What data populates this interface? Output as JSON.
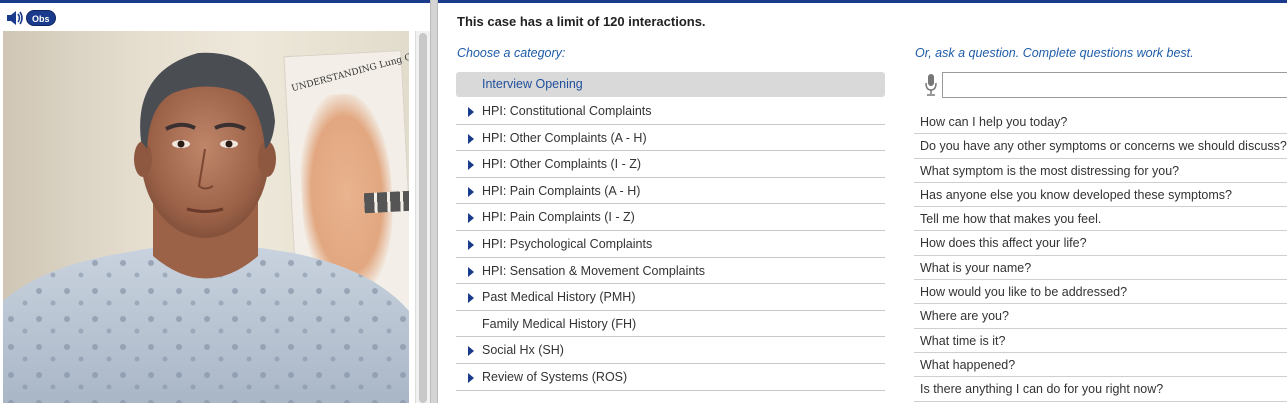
{
  "media": {
    "obs_label": "Obs"
  },
  "poster": {
    "title": "UNDERSTANDING Lung Cancer"
  },
  "header": {
    "limit_text": "This case has a limit of 120 interactions."
  },
  "categories": {
    "prompt": "Choose a category:",
    "items": [
      {
        "label": "Interview Opening",
        "expandable": false,
        "selected": true
      },
      {
        "label": "HPI: Constitutional Complaints",
        "expandable": true
      },
      {
        "label": "HPI: Other Complaints (A - H)",
        "expandable": true
      },
      {
        "label": "HPI: Other Complaints (I - Z)",
        "expandable": true
      },
      {
        "label": "HPI: Pain Complaints (A - H)",
        "expandable": true
      },
      {
        "label": "HPI: Pain Complaints (I - Z)",
        "expandable": true
      },
      {
        "label": "HPI: Psychological Complaints",
        "expandable": true
      },
      {
        "label": "HPI: Sensation & Movement Complaints",
        "expandable": true
      },
      {
        "label": "Past Medical History (PMH)",
        "expandable": true
      },
      {
        "label": "Family Medical History (FH)",
        "expandable": false
      },
      {
        "label": "Social Hx (SH)",
        "expandable": true
      },
      {
        "label": "Review of Systems (ROS)",
        "expandable": true
      }
    ]
  },
  "ask": {
    "prompt": "Or, ask a question. Complete questions work best.",
    "input_value": "",
    "questions": [
      "How can I help you today?",
      "Do you have any other symptoms or concerns we should discuss?",
      "What symptom is the most distressing for you?",
      "Has anyone else you know developed these symptoms?",
      "Tell me how that makes you feel.",
      "How does this affect your life?",
      "What is your name?",
      "How would you like to be addressed?",
      "Where are you?",
      "What time is it?",
      "What happened?",
      "Is there anything I can do for you right now?"
    ]
  },
  "colors": {
    "accent": "#1a3a8c",
    "link": "#1f5ca8",
    "selected_bg": "#d9d9d9"
  },
  "icons": {
    "speaker": "speaker-icon",
    "mic": "microphone-icon",
    "expand": "triangle-right-icon"
  }
}
